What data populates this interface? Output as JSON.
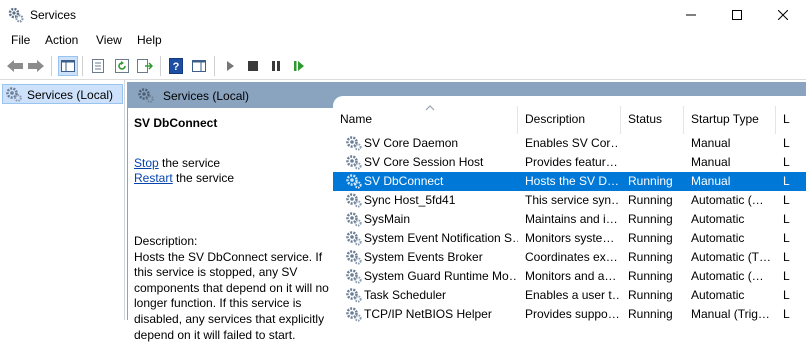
{
  "window": {
    "title": "Services",
    "minimize_glyph": "—",
    "maximize_glyph": "☐",
    "close_glyph": "✕"
  },
  "menu": {
    "items": [
      "File",
      "Action",
      "View",
      "Help"
    ]
  },
  "toolbar": {
    "icons": [
      "back-arrow-icon",
      "forward-arrow-icon",
      "show-hide-console-tree-icon",
      "properties-icon",
      "refresh-icon",
      "export-list-icon",
      "help-icon",
      "show-action-pane-icon",
      "start-service-icon",
      "stop-service-icon",
      "pause-service-icon",
      "resume-service-icon"
    ]
  },
  "tree": {
    "selected_label": "Services (Local)"
  },
  "pane": {
    "header_label": "Services (Local)",
    "extended": {
      "title": "SV DbConnect",
      "stop_link": "Stop",
      "stop_suffix": " the service",
      "restart_link": "Restart",
      "restart_suffix": " the service",
      "description_label": "Description:",
      "description_text": "Hosts the SV DbConnect service. If this service is stopped, any SV components that depend on it will no longer function. If this service is disabled, any services that explicitly depend on it will failed to start."
    },
    "columns": [
      "Name",
      "Description",
      "Status",
      "Startup Type",
      "L"
    ],
    "sort_indicator": "^",
    "rows": [
      {
        "name": "SV Core Daemon",
        "description": "Enables SV Cor…",
        "status": "",
        "startup": "Manual",
        "logon": "L"
      },
      {
        "name": "SV Core Session Host",
        "description": "Provides featur…",
        "status": "",
        "startup": "Manual",
        "logon": "L"
      },
      {
        "name": "SV DbConnect",
        "description": "Hosts the SV D…",
        "status": "Running",
        "startup": "Manual",
        "logon": "L"
      },
      {
        "name": "Sync Host_5fd41",
        "description": "This service syn…",
        "status": "Running",
        "startup": "Automatic (…",
        "logon": "L"
      },
      {
        "name": "SysMain",
        "description": "Maintains and i…",
        "status": "Running",
        "startup": "Automatic",
        "logon": "L"
      },
      {
        "name": "System Event Notification S…",
        "description": "Monitors syste…",
        "status": "Running",
        "startup": "Automatic",
        "logon": "L"
      },
      {
        "name": "System Events Broker",
        "description": "Coordinates ex…",
        "status": "Running",
        "startup": "Automatic (T…",
        "logon": "L"
      },
      {
        "name": "System Guard Runtime Mo…",
        "description": "Monitors and a…",
        "status": "Running",
        "startup": "Automatic (…",
        "logon": "L"
      },
      {
        "name": "Task Scheduler",
        "description": "Enables a user t…",
        "status": "Running",
        "startup": "Automatic",
        "logon": "L"
      },
      {
        "name": "TCP/IP NetBIOS Helper",
        "description": "Provides suppo…",
        "status": "Running",
        "startup": "Manual (Trig…",
        "logon": "L"
      }
    ],
    "selected_row_index": 2
  },
  "colors": {
    "pane_header": "#8aa4c0",
    "selection": "#0078d7",
    "tree_selection": "#cde2fa",
    "link": "#0645ad"
  }
}
